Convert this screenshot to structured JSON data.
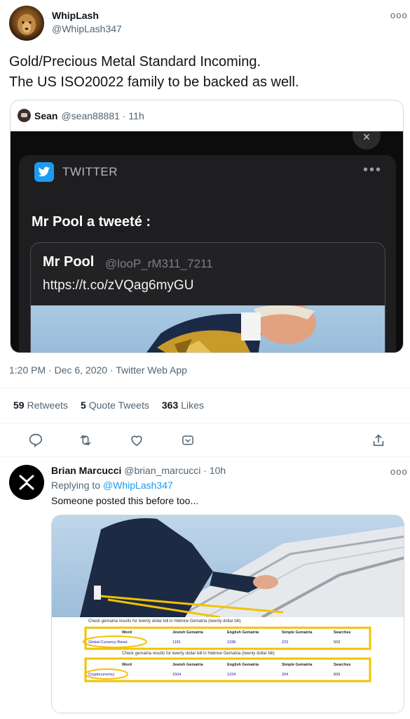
{
  "tweet": {
    "display_name": "WhipLash",
    "handle": "@WhipLash347",
    "text": "Gold/Precious Metal Standard Incoming.\nThe US ISO20022 family to be backed as well.",
    "more_label": "ooo"
  },
  "quote": {
    "display_name": "Sean",
    "handle": "@sean88881 · 11h",
    "screenshot": {
      "app_name": "TWITTER",
      "dots": "•••",
      "close": "×",
      "title": "Mr Pool a tweeté :",
      "inner_name": "Mr Pool",
      "inner_handle": "@looP_rM311_7211",
      "inner_link": "https://t.co/zVQag6myGU"
    }
  },
  "meta": {
    "timestamp": "1:20 PM · Dec 6, 2020 · Twitter Web App"
  },
  "stats": {
    "retweets_count": "59",
    "retweets_label": "Retweets",
    "quote_count": "5",
    "quote_label": "Quote Tweets",
    "likes_count": "363",
    "likes_label": "Likes"
  },
  "actions": [
    "reply-icon",
    "retweet-icon",
    "like-icon",
    "tip-icon",
    "share-icon"
  ],
  "reply": {
    "display_name": "Brian Marcucci",
    "handle": "@brian_marcucci · 10h",
    "replying_prefix": "Replying to",
    "replying_to": "@WhipLash347",
    "text": "Someone posted this before too...",
    "more_label": "ooo",
    "image": {
      "caption1": "Check gematria results for twenty dollar bill in Hebrew Gematria (twenty dollar bill)",
      "caption2": "Check gematria results for twenty dollar bill in Hebrew Gematria (twenty dollar bill)",
      "headers": [
        "Word",
        "Jewish Gematria",
        "English Gematria",
        "Simple Gematria",
        "Searches"
      ],
      "row1": [
        "Global Currency Reset",
        "1191",
        "1338",
        "223",
        "503"
      ],
      "row2": [
        "Cryptocurrency",
        "1504",
        "1224",
        "204",
        "839"
      ]
    }
  },
  "colors": {
    "accent": "#1d9bf0",
    "muted": "#536471",
    "highlight": "#f2c200"
  }
}
